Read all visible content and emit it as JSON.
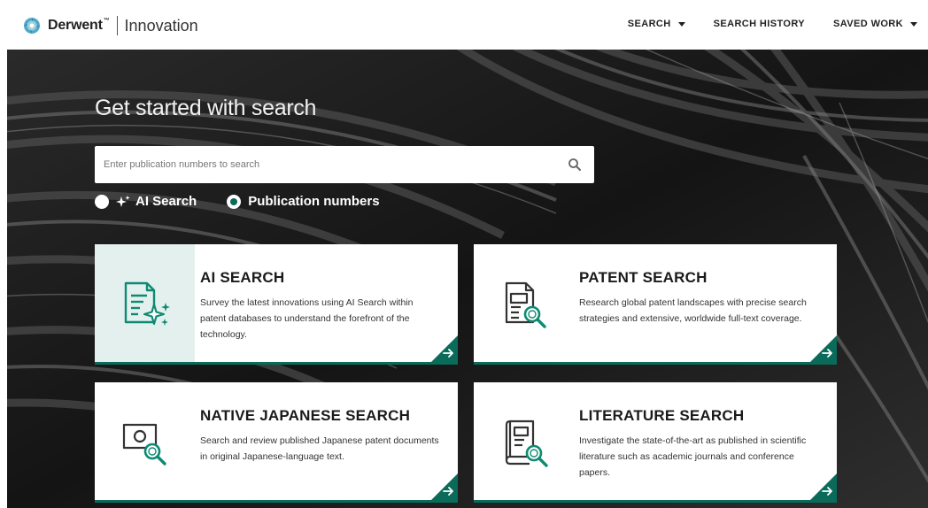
{
  "brand": {
    "name": "Derwent",
    "tm": "™",
    "product": "Innovation"
  },
  "nav": [
    {
      "label": "SEARCH",
      "dropdown": true
    },
    {
      "label": "SEARCH HISTORY",
      "dropdown": false
    },
    {
      "label": "SAVED WORK",
      "dropdown": true
    }
  ],
  "hero": {
    "title": "Get started with search",
    "search": {
      "placeholder": "Enter publication numbers to search",
      "value": ""
    },
    "search_mode": {
      "options": [
        {
          "label": "AI Search",
          "selected": false,
          "icon": "sparkle-icon"
        },
        {
          "label": "Publication numbers",
          "selected": true
        }
      ]
    }
  },
  "cards": [
    {
      "title": "AI SEARCH",
      "description": "Survey the latest innovations using AI Search within patent databases to understand the forefront of the technology.",
      "icon": "ai-document-sparkle-icon",
      "highlighted": true
    },
    {
      "title": "PATENT SEARCH",
      "description": "Research global patent landscapes with precise search strategies and extensive, worldwide full-text coverage.",
      "icon": "document-magnifier-icon",
      "highlighted": false
    },
    {
      "title": "NATIVE JAPANESE SEARCH",
      "description": "Search and review published Japanese patent documents in original Japanese-language text.",
      "icon": "japan-flag-magnifier-icon",
      "highlighted": false
    },
    {
      "title": "LITERATURE SEARCH",
      "description": "Investigate the state-of-the-art as published in scientific literature such as academic journals and conference papers.",
      "icon": "book-magnifier-icon",
      "highlighted": false
    }
  ],
  "colors": {
    "accent": "#0a6b5a",
    "icon_teal": "#0e8a73",
    "card_highlight": "#e4f0ee"
  }
}
